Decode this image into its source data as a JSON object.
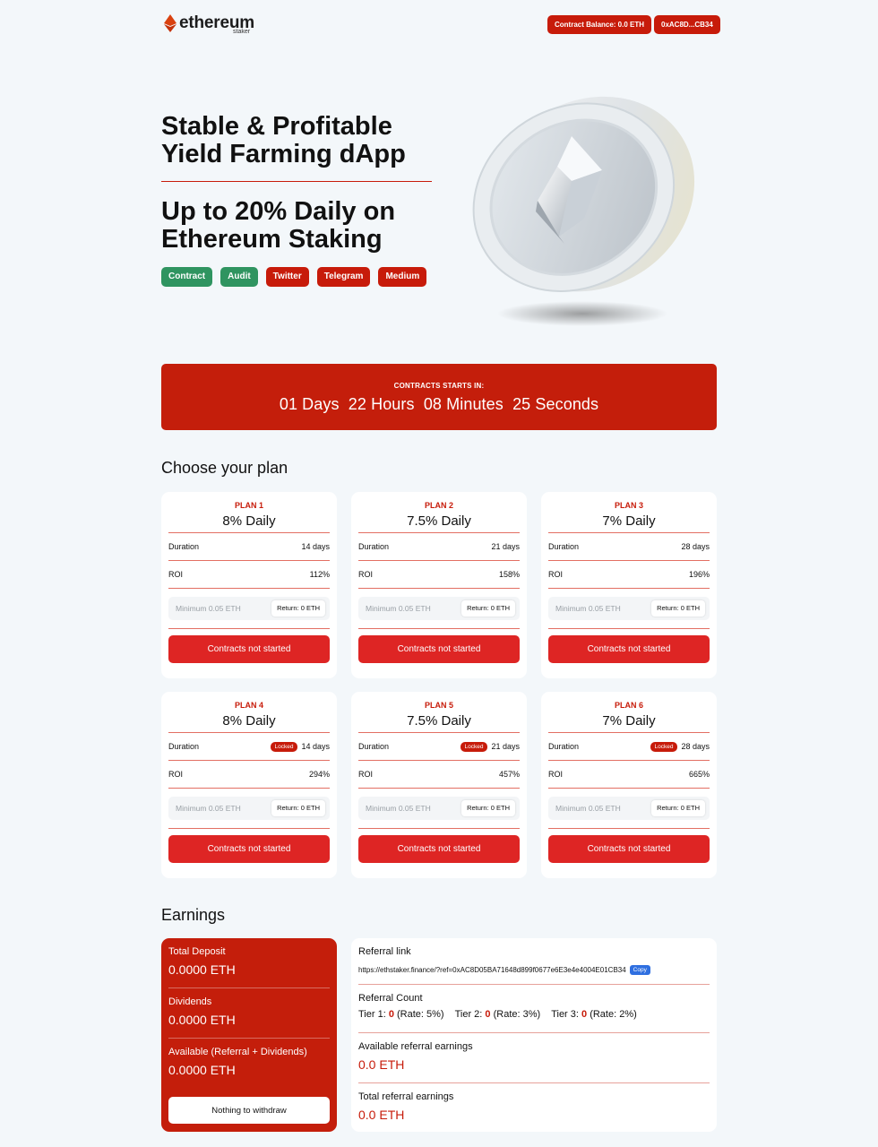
{
  "header": {
    "logo_text": "ethereum",
    "logo_sub": "staker",
    "contract_balance": "Contract Balance: 0.0 ETH",
    "wallet": "0xAC8D...CB34"
  },
  "hero": {
    "title": "Stable & Profitable Yield Farming dApp",
    "subtitle": "Up to 20% Daily on Ethereum Staking",
    "links": [
      "Contract",
      "Audit",
      "Twitter",
      "Telegram",
      "Medium"
    ]
  },
  "countdown": {
    "label": "CONTRACTS STARTS IN:",
    "time": "01 Days  22 Hours  08 Minutes  25 Seconds"
  },
  "plans_title": "Choose your plan",
  "plan_labels": {
    "duration": "Duration",
    "roi": "ROI",
    "placeholder": "Minimum 0.05 ETH",
    "return": "Return: 0 ETH",
    "button": "Contracts not started",
    "locked": "Locked"
  },
  "plans": [
    {
      "name": "PLAN 1",
      "rate": "8% Daily",
      "duration": "14 days",
      "roi": "112%",
      "locked": false
    },
    {
      "name": "PLAN 2",
      "rate": "7.5% Daily",
      "duration": "21 days",
      "roi": "158%",
      "locked": false
    },
    {
      "name": "PLAN 3",
      "rate": "7% Daily",
      "duration": "28 days",
      "roi": "196%",
      "locked": false
    },
    {
      "name": "PLAN 4",
      "rate": "8% Daily",
      "duration": "14 days",
      "roi": "294%",
      "locked": true
    },
    {
      "name": "PLAN 5",
      "rate": "7.5% Daily",
      "duration": "21 days",
      "roi": "457%",
      "locked": true
    },
    {
      "name": "PLAN 6",
      "rate": "7% Daily",
      "duration": "28 days",
      "roi": "665%",
      "locked": true
    }
  ],
  "earnings_title": "Earnings",
  "earnings": {
    "total_deposit_label": "Total Deposit",
    "total_deposit": "0.0000 ETH",
    "dividends_label": "Dividends",
    "dividends": "0.0000 ETH",
    "available_label": "Available (Referral + Dividends)",
    "available": "0.0000 ETH",
    "withdraw_button": "Nothing to withdraw"
  },
  "referral": {
    "link_label": "Referral link",
    "link": "https://ethstaker.finance/?ref=0xAC8D05BA71648d899f0677e6E3e4e4004E01CB34",
    "copy": "Copy",
    "count_label": "Referral Count",
    "tier1_label": "Tier 1:",
    "tier1_count": "0",
    "tier1_rate": "(Rate: 5%)",
    "tier2_label": "Tier 2:",
    "tier2_count": "0",
    "tier2_rate": "(Rate: 3%)",
    "tier3_label": "Tier 3:",
    "tier3_count": "0",
    "tier3_rate": "(Rate: 2%)",
    "available_label": "Available referral earnings",
    "available": "0.0 ETH",
    "total_label": "Total referral earnings",
    "total": "0.0 ETH"
  }
}
